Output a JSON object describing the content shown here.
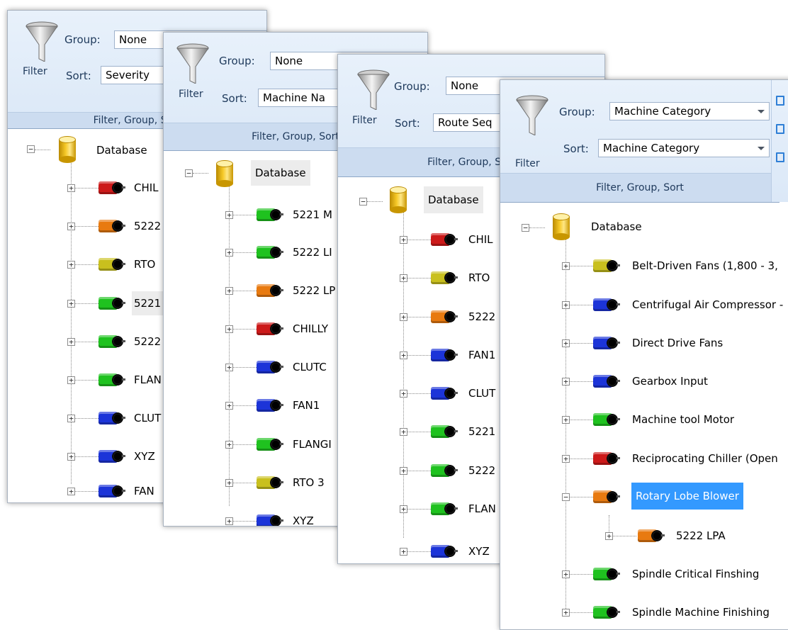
{
  "ribbon": {
    "filter_label": "Filter",
    "group_label": "Group:",
    "sort_label": "Sort:",
    "section_label": "Filter, Group, Sort"
  },
  "colors": {
    "red": "#cc1a1a",
    "orange": "#e87a10",
    "yellow": "#c9c01e",
    "green": "#1fc21f",
    "blue": "#1c34d8",
    "selection": "#3399ff"
  },
  "panels": [
    {
      "group_value": "None",
      "sort_value": "Severity",
      "root_label": "Database",
      "items": [
        {
          "label": "CHIL",
          "color": "red"
        },
        {
          "label": "5222",
          "color": "orange"
        },
        {
          "label": "RTO",
          "color": "yellow"
        },
        {
          "label": "5221",
          "color": "green"
        },
        {
          "label": "5222",
          "color": "green"
        },
        {
          "label": "FLAN",
          "color": "green"
        },
        {
          "label": "CLUT",
          "color": "blue"
        },
        {
          "label": "XYZ",
          "color": "blue"
        },
        {
          "label": "FAN",
          "color": "blue"
        }
      ]
    },
    {
      "group_value": "None",
      "sort_value": "Machine Na",
      "root_label": "Database",
      "items": [
        {
          "label": "5221 M",
          "color": "green"
        },
        {
          "label": "5222 LI",
          "color": "green"
        },
        {
          "label": "5222 LP",
          "color": "orange"
        },
        {
          "label": "CHILLY",
          "color": "red"
        },
        {
          "label": "CLUTC",
          "color": "blue"
        },
        {
          "label": "FAN1",
          "color": "blue"
        },
        {
          "label": "FLANGI",
          "color": "green"
        },
        {
          "label": "RTO 3",
          "color": "yellow"
        },
        {
          "label": "XYZ",
          "color": "blue"
        }
      ]
    },
    {
      "group_value": "None",
      "sort_value": "Route Seq",
      "root_label": "Database",
      "items": [
        {
          "label": "CHIL",
          "color": "red"
        },
        {
          "label": "RTO",
          "color": "yellow"
        },
        {
          "label": "5222",
          "color": "orange"
        },
        {
          "label": "FAN1",
          "color": "blue"
        },
        {
          "label": "CLUT",
          "color": "blue"
        },
        {
          "label": "5221",
          "color": "green"
        },
        {
          "label": "5222",
          "color": "green"
        },
        {
          "label": "FLAN",
          "color": "green"
        },
        {
          "label": "XYZ",
          "color": "blue"
        }
      ]
    },
    {
      "group_value": "Machine Category",
      "sort_value": "Machine Category",
      "root_label": "Database",
      "items": [
        {
          "label": "Belt-Driven Fans (1,800 - 3,",
          "color": "yellow"
        },
        {
          "label": "Centrifugal Air Compressor -",
          "color": "blue"
        },
        {
          "label": "Direct Drive Fans",
          "color": "blue"
        },
        {
          "label": "Gearbox Input",
          "color": "blue"
        },
        {
          "label": "Machine tool Motor",
          "color": "green"
        },
        {
          "label": "Reciprocating Chiller (Open",
          "color": "red"
        },
        {
          "label": "Rotary Lobe Blower",
          "color": "orange"
        },
        {
          "label": "5222 LPA",
          "color": "orange"
        },
        {
          "label": "Spindle Critical Finshing",
          "color": "green"
        },
        {
          "label": "Spindle Machine Finishing",
          "color": "green"
        }
      ]
    }
  ]
}
